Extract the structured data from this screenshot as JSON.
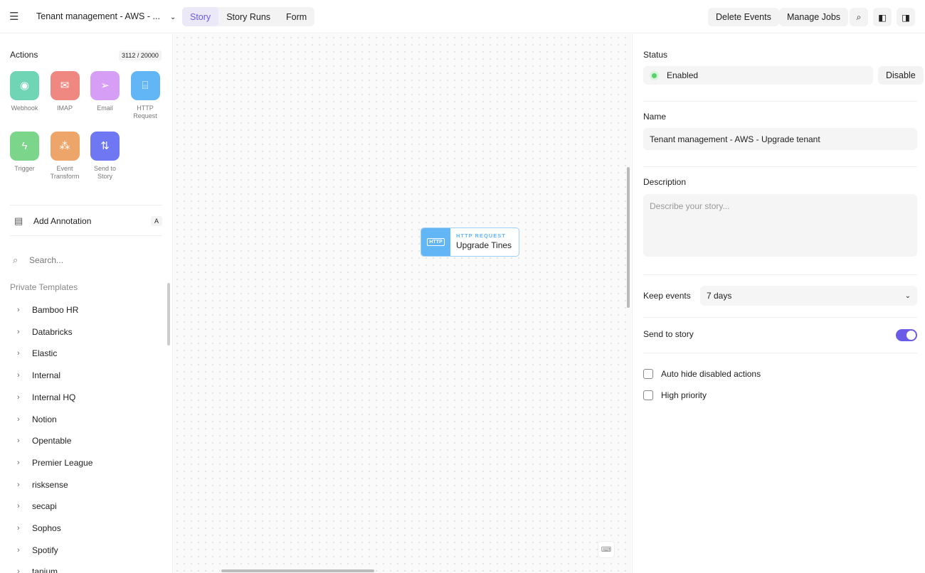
{
  "header": {
    "story_title": "Tenant management - AWS - ...",
    "tabs": [
      "Story",
      "Story Runs",
      "Form"
    ],
    "delete_events": "Delete Events",
    "manage_jobs": "Manage Jobs"
  },
  "actions": {
    "title": "Actions",
    "count": "3112 / 20000",
    "items": [
      {
        "label": "Webhook",
        "color": "#6fd5b4",
        "icon": "broadcast-icon"
      },
      {
        "label": "IMAP",
        "color": "#ef8880",
        "icon": "mail-icon"
      },
      {
        "label": "Email",
        "color": "#d79ef5",
        "icon": "send-icon"
      },
      {
        "label": "HTTP Request",
        "color": "#63b6f6",
        "icon": "http-icon"
      },
      {
        "label": "Trigger",
        "color": "#7bd58a",
        "icon": "bolt-icon"
      },
      {
        "label": "Event Transform",
        "color": "#eda56a",
        "icon": "shapes-icon"
      },
      {
        "label": "Send to Story",
        "color": "#6f78f2",
        "icon": "route-icon"
      }
    ]
  },
  "annotation": {
    "label": "Add Annotation",
    "shortcut": "A"
  },
  "search": {
    "placeholder": "Search..."
  },
  "templates": {
    "title": "Private Templates",
    "items": [
      "Bamboo HR",
      "Databricks",
      "Elastic",
      "Internal",
      "Internal HQ",
      "Notion",
      "Opentable",
      "Premier League",
      "risksense",
      "secapi",
      "Sophos",
      "Spotify",
      "tanium"
    ]
  },
  "node": {
    "type": "HTTP REQUEST",
    "name": "Upgrade Tines",
    "icon_text": "HTTP"
  },
  "panel": {
    "status_label": "Status",
    "status_value": "Enabled",
    "disable": "Disable",
    "name_label": "Name",
    "name_value": "Tenant management - AWS - Upgrade tenant",
    "desc_label": "Description",
    "desc_placeholder": "Describe your story...",
    "keep_label": "Keep events",
    "keep_value": "7 days",
    "send_label": "Send to story",
    "send_enabled": true,
    "auto_hide": "Auto hide disabled actions",
    "high_priority": "High priority"
  }
}
